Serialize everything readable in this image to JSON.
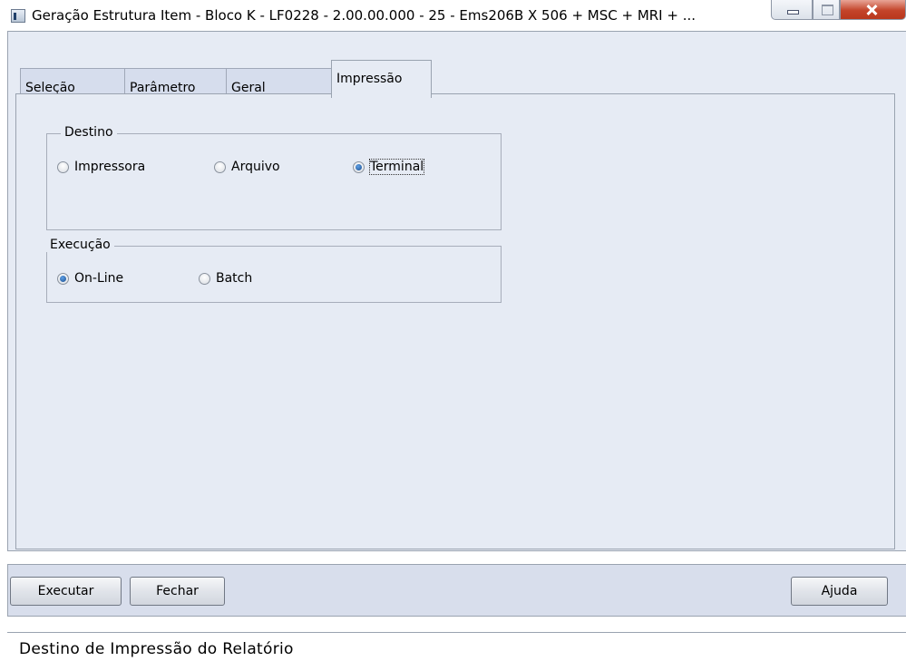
{
  "window": {
    "title": "Geração Estrutura Item - Bloco K - LF0228 - 2.00.00.000 - 25 - Ems206B X 506 + MSC + MRI + ..."
  },
  "tabs": [
    {
      "label": "Seleção"
    },
    {
      "label": "Parâmetro"
    },
    {
      "label": "Geral"
    },
    {
      "label": "Impressão",
      "active": true
    }
  ],
  "destino": {
    "legend": "Destino",
    "options": [
      {
        "label": "Impressora",
        "checked": false
      },
      {
        "label": "Arquivo",
        "checked": false
      },
      {
        "label": "Terminal",
        "checked": true
      }
    ]
  },
  "execucao": {
    "legend": "Execução",
    "options": [
      {
        "label": "On-Line",
        "checked": true
      },
      {
        "label": "Batch",
        "checked": false
      }
    ]
  },
  "buttons": {
    "executar": "Executar",
    "fechar": "Fechar",
    "ajuda": "Ajuda"
  },
  "status": {
    "text": "Destino de Impressão do Relatório"
  }
}
